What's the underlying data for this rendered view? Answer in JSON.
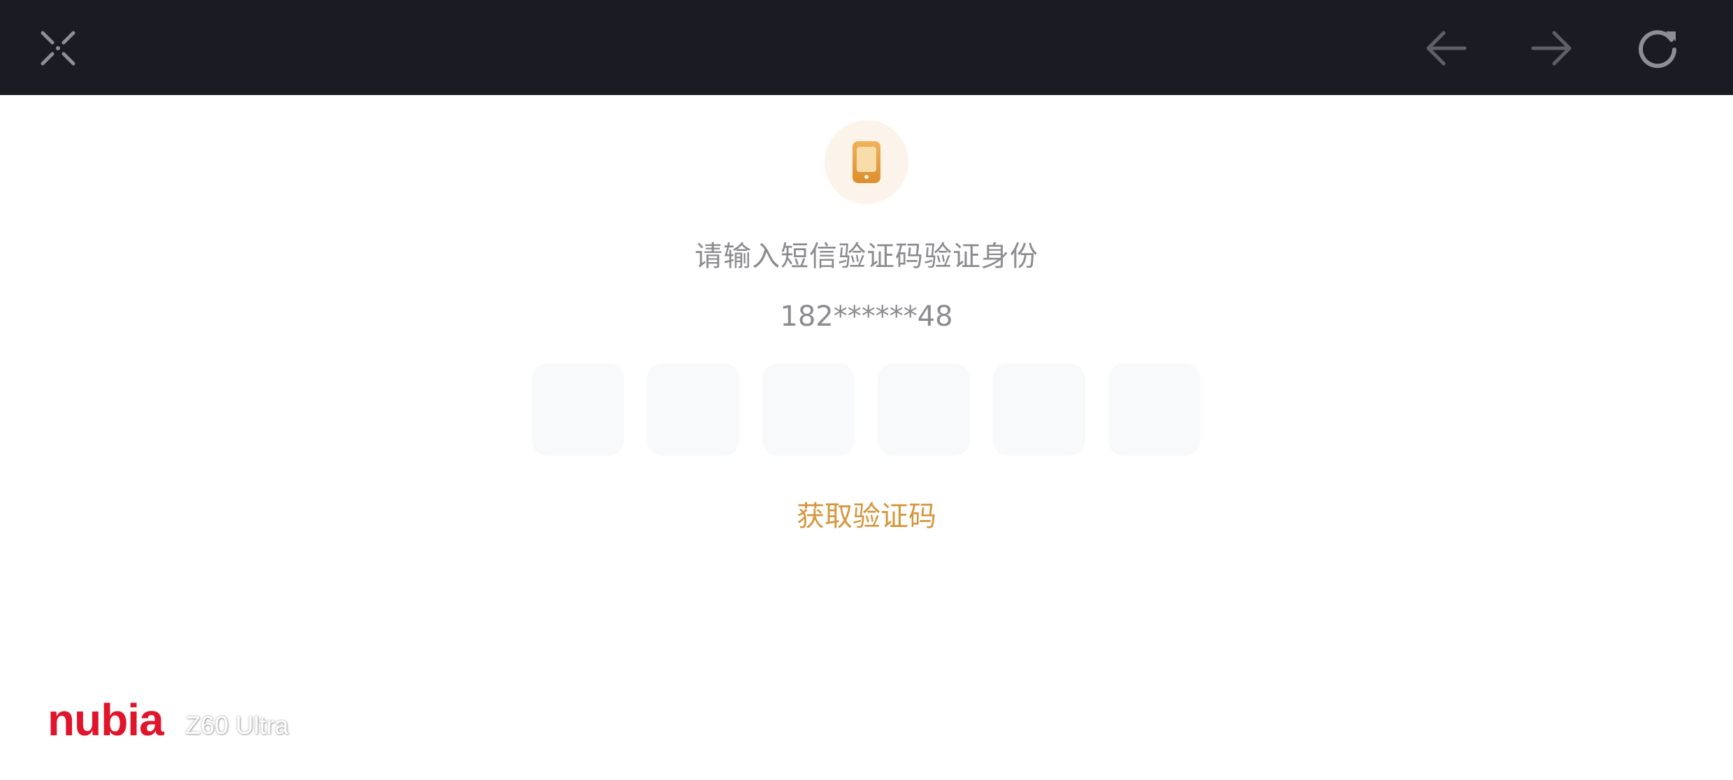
{
  "toolbar": {
    "close_icon": "close-icon",
    "back_icon": "arrow-left-icon",
    "forward_icon": "arrow-right-icon",
    "refresh_icon": "refresh-icon"
  },
  "verify": {
    "icon": "phone-icon",
    "prompt": "请输入短信验证码验证身份",
    "phone_number": "182******48",
    "code_digits": [
      "",
      "",
      "",
      "",
      "",
      ""
    ],
    "get_code_label": "获取验证码"
  },
  "watermark": {
    "brand": "nubia",
    "model": "Z60 Ultra"
  },
  "colors": {
    "toolbar_bg": "#1b1c23",
    "accent": "#d4973d",
    "brand_red": "#e0142b",
    "text_gray": "#8c8c90",
    "input_bg": "#f8f9fb"
  }
}
